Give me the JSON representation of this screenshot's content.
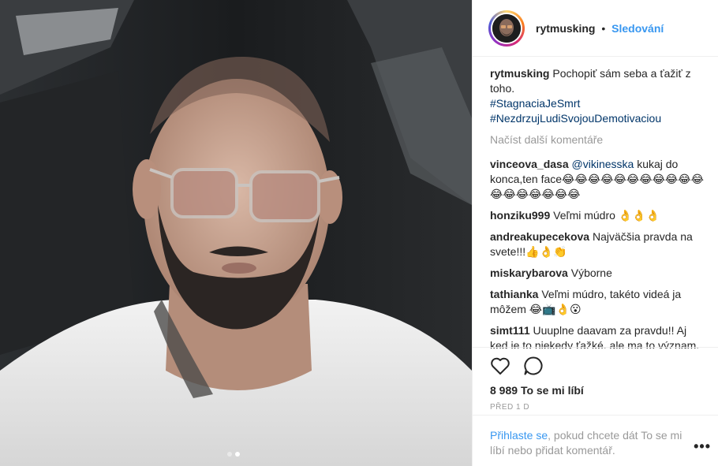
{
  "header": {
    "username": "rytmusking",
    "separator": "•",
    "follow_label": "Sledování"
  },
  "caption": {
    "username": "rytmusking",
    "text": "Pochopiť sám seba a ťažiť z toho.",
    "hashtags": [
      "#StagnaciaJeSmrt",
      "#NezdrzujLudiSvojouDemotivaciou"
    ]
  },
  "load_more_label": "Načíst další komentáře",
  "comments": [
    {
      "user": "vinceova_dasa",
      "mention": "@vikinesska",
      "text": " kukaj do konca,ten face😂😂😂😂😂😂😂😂😂😂😂😂😂😂😂😂😂😂"
    },
    {
      "user": "honziku999",
      "mention": "",
      "text": " Veľmi múdro 👌👌👌"
    },
    {
      "user": "andreakupecekova",
      "mention": "",
      "text": " Najväčšia pravda na svete!!!👍👌👏"
    },
    {
      "user": "miskarybarova",
      "mention": "",
      "text": " Výborne"
    },
    {
      "user": "tathianka",
      "mention": "",
      "text": " Veľmi múdro, takéto videá ja môžem 😂📺👌😮"
    },
    {
      "user": "simt111",
      "mention": "",
      "text": " Uuuplne daavam za pravdu!! Aj ked je to niekedy ťažké, ale ma to význam. Odstranit negatívnych ludi zo svojho života,"
    }
  ],
  "likes": {
    "count": "8 989",
    "label": "To se mi líbí"
  },
  "timestamp": "PŘED 1 D",
  "footer": {
    "login_link": "Přihlaste se",
    "text": ", pokud chcete dát To se mi líbí nebo přidat komentář."
  },
  "more_label": "•••",
  "icons": {
    "like": "heart-icon",
    "comment": "comment-icon",
    "more": "more-options-icon"
  },
  "colors": {
    "link_blue": "#3897f0",
    "hashtag": "#003569",
    "muted": "#999999"
  },
  "carousel": {
    "count": 2,
    "active": 2
  }
}
